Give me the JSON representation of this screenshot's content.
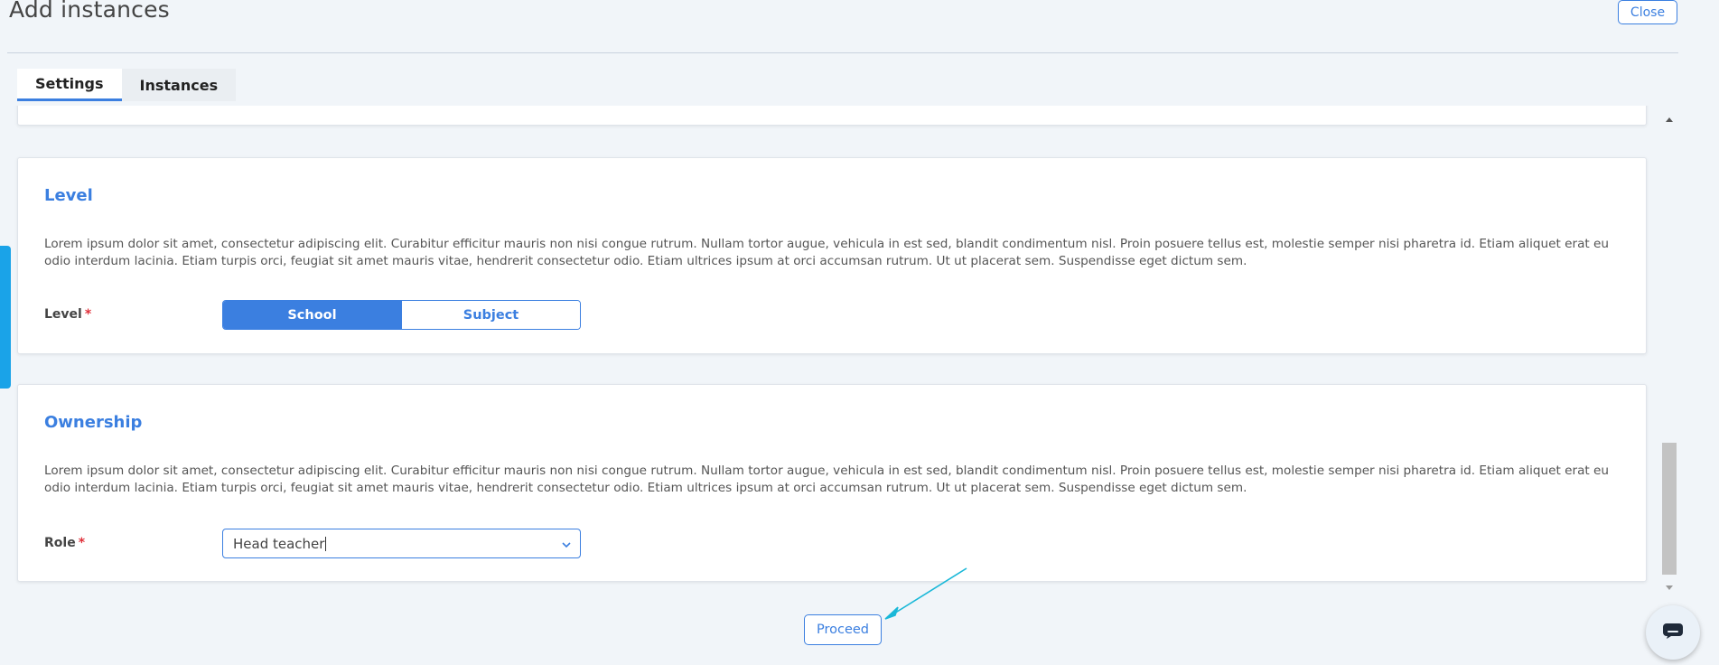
{
  "modal": {
    "title": "Add instances",
    "close_label": "Close"
  },
  "tabs": [
    {
      "label": "Settings",
      "active": true
    },
    {
      "label": "Instances",
      "active": false
    }
  ],
  "level_section": {
    "heading": "Level",
    "description": "Lorem ipsum dolor sit amet, consectetur adipiscing elit. Curabitur efficitur mauris non nisi congue rutrum. Nullam tortor augue, vehicula in est sed, blandit condimentum nisl. Proin posuere tellus est, molestie semper nisi pharetra id. Etiam aliquet erat eu odio interdum lacinia. Etiam turpis orci, feugiat sit amet mauris vitae, hendrerit consectetur odio. Etiam ultrices ipsum at orci accumsan rutrum. Ut ut placerat sem. Suspendisse eget dictum sem.",
    "field_label": "Level",
    "required_mark": "*",
    "options": [
      {
        "label": "School",
        "selected": true
      },
      {
        "label": "Subject",
        "selected": false
      }
    ]
  },
  "ownership_section": {
    "heading": "Ownership",
    "description": "Lorem ipsum dolor sit amet, consectetur adipiscing elit. Curabitur efficitur mauris non nisi congue rutrum. Nullam tortor augue, vehicula in est sed, blandit condimentum nisl. Proin posuere tellus est, molestie semper nisi pharetra id. Etiam aliquet erat eu odio interdum lacinia. Etiam turpis orci, feugiat sit amet mauris vitae, hendrerit consectetur odio. Etiam ultrices ipsum at orci accumsan rutrum. Ut ut placerat sem. Suspendisse eget dictum sem.",
    "field_label": "Role",
    "required_mark": "*",
    "role_value": "Head teacher"
  },
  "footer": {
    "proceed_label": "Proceed"
  },
  "icons": {
    "chevron": "chevron-down-icon",
    "chat": "chat-icon",
    "annotation": "arrow-annotation"
  },
  "colors": {
    "accent": "#3b7fe0",
    "side_tab": "#1aa3e8",
    "annotation_arrow": "#1ab8d8",
    "required": "#e0303a"
  }
}
